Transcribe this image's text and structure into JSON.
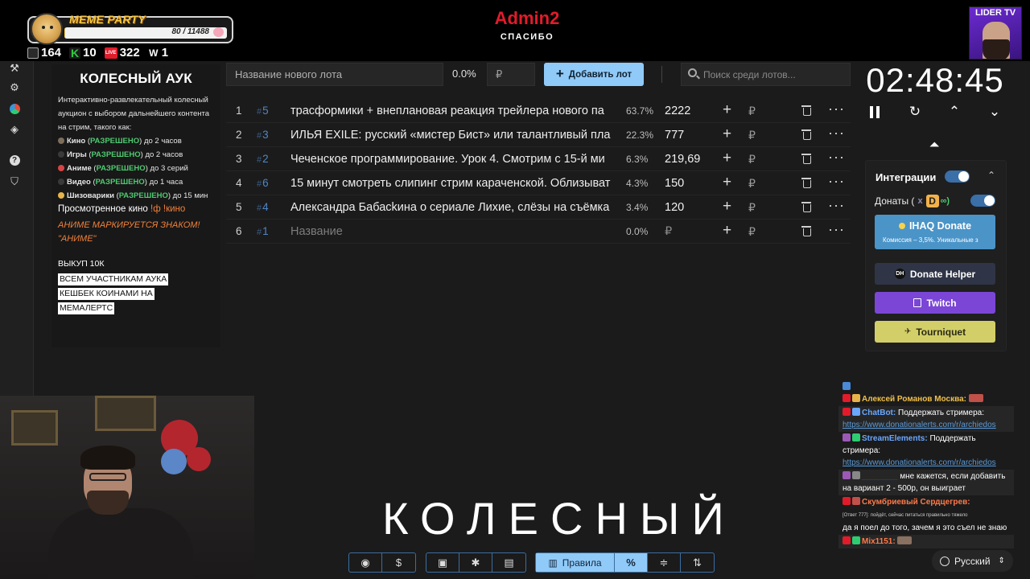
{
  "overlay": {
    "meme_party": {
      "title": "MEME PARTY",
      "current": 80,
      "target": 11488,
      "progress": 0.007
    },
    "stats": [
      {
        "icon": "twitch-icon",
        "value": "164",
        "color": "#9b59b6"
      },
      {
        "icon": "kick-icon",
        "value": "10",
        "color": "#2ecc40"
      },
      {
        "icon": "live-icon",
        "value": "322",
        "color": "#e21b2b"
      },
      {
        "icon": "w-icon",
        "value": "1",
        "color": "#555555"
      }
    ],
    "top_label": "Admin2",
    "top_sub": "СПАСИБО",
    "channel_badge": "LIDER TV",
    "big_word": "КОЛЕСНЫЙ",
    "count_label": "80 / 11488"
  },
  "info_panel": {
    "title": "КОЛЕСНЫЙ АУК",
    "description": "Интерактивно-развлекательный колесный аукцион с выбором дальнейшего контента на стрим, такого как:",
    "rules": [
      {
        "category": "Кино",
        "status": "РАЗРЕШЕНО",
        "limit": "до 2 часов",
        "color": "#7d6e5a"
      },
      {
        "category": "Игры",
        "status": "РАЗРЕШЕНО",
        "limit": "до 2 часов",
        "color": "#3a3a3a"
      },
      {
        "category": "Аниме",
        "status": "РАЗРЕШЕНО",
        "limit": "до 3 серий",
        "color": "#d64545"
      },
      {
        "category": "Видео",
        "status": "РАЗРЕШЕНО",
        "limit": "до 1 часа",
        "color": "#3a3a3a"
      },
      {
        "category": "Шизоварики",
        "status": "РАЗРЕШЕНО",
        "limit": "до 15 мин",
        "color": "#e8b44a"
      }
    ],
    "rule_open": "(",
    "rule_close": ")",
    "watched_label": "Просмотренное кино",
    "watched_cmd": "!ф !кино",
    "anime_note": "АНИМЕ МАРКИРУЕТСЯ ЗНАКОМ! \"АНИМЕ\"",
    "buyout": "ВЫКУП 10К",
    "cashback": [
      "ВСЕМ УЧАСТНИКАМ АУКА",
      "КЕШБЕК КОИНАМИ НА",
      "МЕМАЛЕРТС"
    ]
  },
  "lot_form": {
    "name_placeholder": "Название нового лота",
    "percent": "0.0%",
    "currency": "₽",
    "add_label": "Добавить лот",
    "search_placeholder": "Поиск среди лотов..."
  },
  "lots": [
    {
      "num": "1",
      "id": "5",
      "name": "трасформики + внеплановая реакция трейлера нового па",
      "pct": "63.7%",
      "amount": "2222"
    },
    {
      "num": "2",
      "id": "3",
      "name": "ИЛЬЯ EXILE: русский «мистер Бист» или талантливый пла",
      "pct": "22.3%",
      "amount": "777"
    },
    {
      "num": "3",
      "id": "2",
      "name": "Чеченское программирование. Урок 4. Смотрим с 15-й ми",
      "pct": "6.3%",
      "amount": "219,69"
    },
    {
      "num": "4",
      "id": "6",
      "name": "15 минут смотреть слипинг стрим караченской. Облизыват",
      "pct": "4.3%",
      "amount": "150"
    },
    {
      "num": "5",
      "id": "4",
      "name": "Александра Бабасkина о сериале Лихие, слёзы на съёмка",
      "pct": "3.4%",
      "amount": "120"
    },
    {
      "num": "6",
      "id": "1",
      "name": "Название",
      "pct": "0.0%",
      "amount": "₽",
      "empty": true
    }
  ],
  "lot_symbols": {
    "hash": "#",
    "plus": "+",
    "currency": "₽",
    "more": "···"
  },
  "timer": {
    "time": "02:48:45"
  },
  "integrations": {
    "title": "Интеграции",
    "enabled": true,
    "donations_label": "Донаты (",
    "donations_x": "x",
    "donations_d": "D",
    "donations_ring": "∞)",
    "donations_enabled": true,
    "ihaq_title": "IHAQ Donate",
    "ihaq_sub": "Комиссия – 3,5%. Уникальные з",
    "buttons": [
      {
        "label": "Donate Helper",
        "icon_text": "DH"
      },
      {
        "label": "Twitch"
      },
      {
        "label": "Tourniquet"
      }
    ]
  },
  "toolbar": {
    "rules_label": "Правила",
    "percent_label": "%"
  },
  "language": {
    "label": "Русский"
  },
  "chat": [
    {
      "platform": "live",
      "user": "Алексей Романов Москва:",
      "color": "#f0c04a",
      "text": ""
    },
    {
      "platform": "live",
      "user": "ChatBot:",
      "color": "#6aa8ff",
      "text": "Поддержать стримера:",
      "link": "https://www.donationalerts.com/r/archiedos"
    },
    {
      "platform": "twitch",
      "user": "StreamElements:",
      "color": "#6aa8ff",
      "text": "Поддержать стримера:",
      "link": "https://www.donationalerts.com/r/archiedos"
    },
    {
      "platform": "twitch",
      "user": "",
      "color": "#3a3aff",
      "text": "мне кажется, если добавить на вариант 2 - 500р, он выиграет"
    },
    {
      "platform": "live",
      "user": "Скумбриевый Сердцегрев:",
      "color": "#ff7a4a",
      "text": "да я поел до того, зачем я это съел не знаю",
      "note": "[Ответ 777]: пойдёт, сейчас питаться правильно тяжело"
    },
    {
      "platform": "live",
      "user": "Mix1151:",
      "color": "#ff7a4a",
      "text": ""
    }
  ]
}
